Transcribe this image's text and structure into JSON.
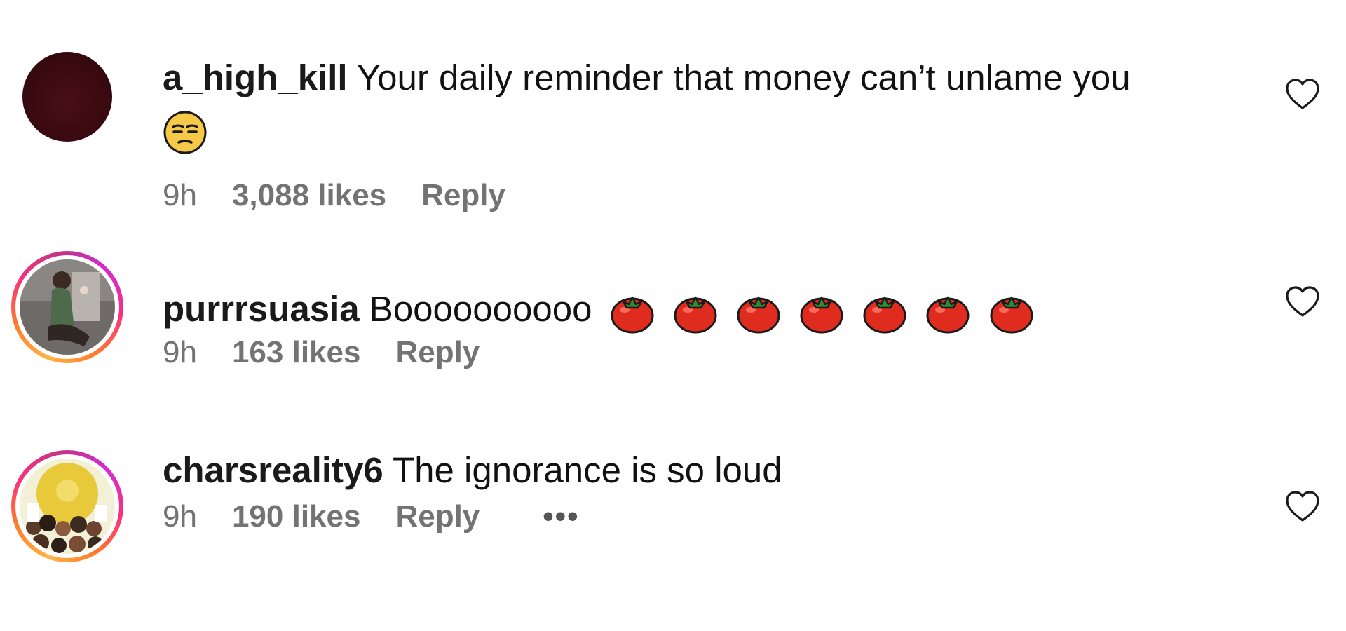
{
  "comments": [
    {
      "username": "a_high_kill",
      "text": "Your daily reminder that money can’t unlame you",
      "emoji": "unamused-face",
      "time": "9h",
      "likes": "3,088 likes",
      "reply": "Reply"
    },
    {
      "username": "purrrsuasia",
      "text": "Boooooooooo",
      "emoji": "tomato",
      "emoji_count": 7,
      "time": "9h",
      "likes": "163 likes",
      "reply": "Reply"
    },
    {
      "username": "charsreality6",
      "text": "The ignorance is so loud",
      "time": "9h",
      "likes": "190 likes",
      "reply": "Reply",
      "more": "•••"
    }
  ],
  "icons": {
    "like": "heart-outline-icon",
    "more": "more-options-icon"
  },
  "colors": {
    "meta_text": "#737373",
    "story_ring_start": "#ffb347",
    "story_ring_end": "#d62ad3"
  }
}
